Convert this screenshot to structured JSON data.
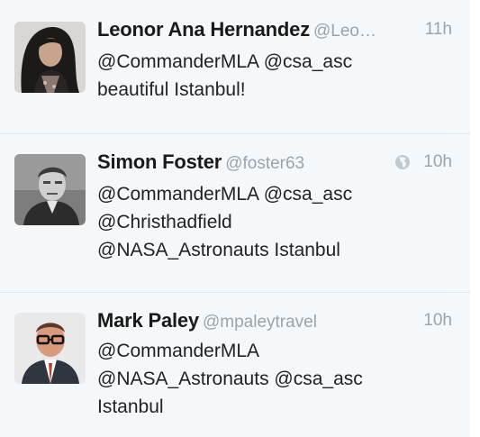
{
  "tweets": [
    {
      "name": "Leonor Ana Hernandez",
      "handle": "@Leo…",
      "time": "11h",
      "lines": [
        "@CommanderMLA @csa_asc",
        "beautiful Istanbul!"
      ],
      "avatar_icon": "woman-dark-hair-avatar"
    },
    {
      "name": "Simon Foster",
      "handle": "@foster63",
      "time": "10h",
      "location_icon": "globe-icon",
      "lines": [
        "@CommanderMLA @csa_asc",
        "@Christhadfield",
        "@NASA_Astronauts Istanbul"
      ],
      "avatar_icon": "man-bw-photo-avatar"
    },
    {
      "name": "Mark Paley",
      "handle": "@mpaleytravel",
      "time": "10h",
      "lines": [
        "@CommanderMLA",
        "@NASA_Astronauts @csa_asc",
        "Istanbul"
      ],
      "avatar_icon": "man-glasses-suit-avatar"
    }
  ],
  "colors": {
    "background": "#f5f8fa",
    "name": "#1a1a1a",
    "meta": "#9aa4ad",
    "text": "#222222",
    "divider": "#e1e8ed"
  }
}
